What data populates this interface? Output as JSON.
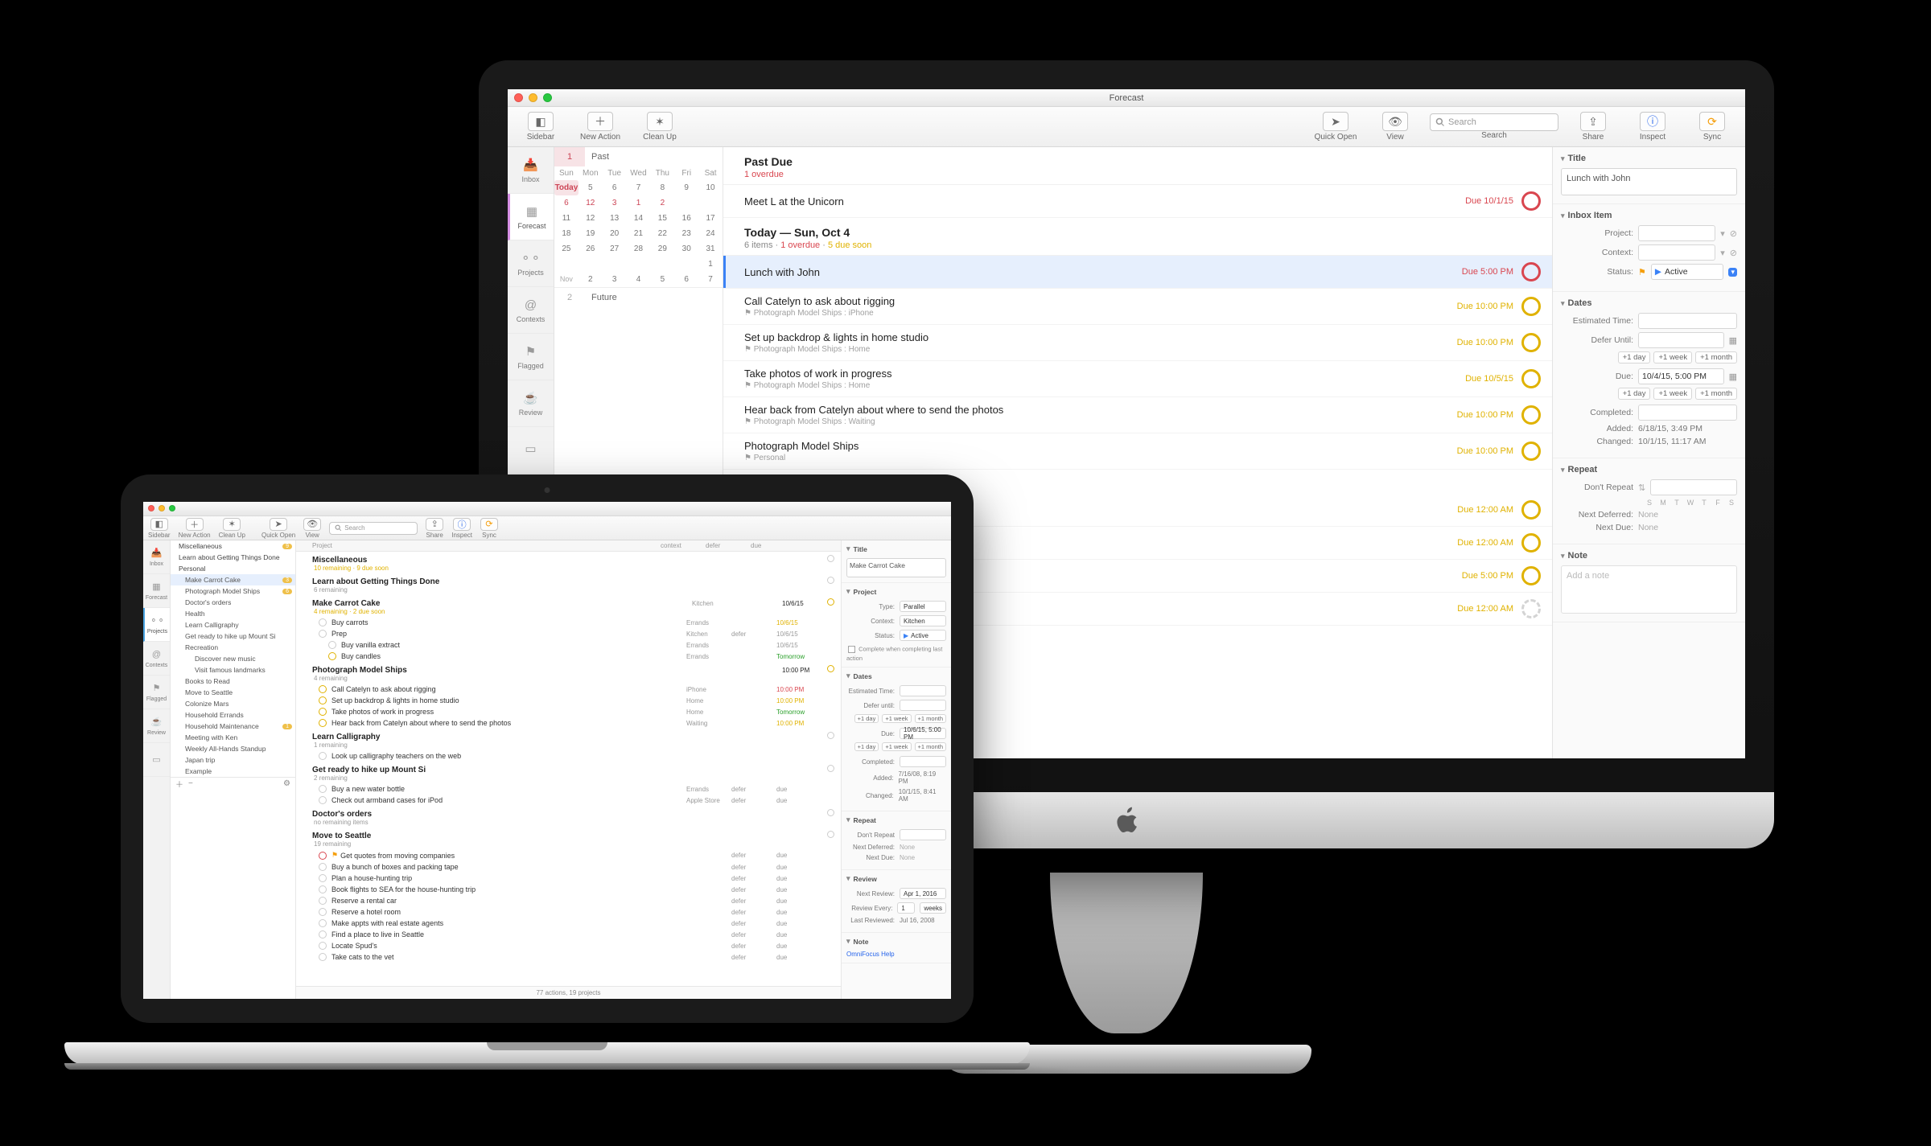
{
  "imac": {
    "windowTitle": "Forecast",
    "toolbar": {
      "sidebar": "Sidebar",
      "newAction": "New Action",
      "cleanUp": "Clean Up",
      "quickOpen": "Quick Open",
      "view": "View",
      "searchPlaceholder": "Search",
      "searchLabel": "Search",
      "share": "Share",
      "inspect": "Inspect",
      "sync": "Sync"
    },
    "perspectives": [
      "Inbox",
      "Forecast",
      "Projects",
      "Contexts",
      "Flagged",
      "Review"
    ],
    "cal": {
      "pastCount": "1",
      "pastLabel": "Past",
      "futureCount": "2",
      "futureLabel": "Future",
      "dowNames": [
        "Sun",
        "Mon",
        "Tue",
        "Wed",
        "Thu",
        "Fri",
        "Sat"
      ],
      "todayLabel": "Today",
      "rows": [
        [
          "Today",
          "5",
          "6",
          "7",
          "8",
          "9",
          "10"
        ],
        [
          "6",
          "12",
          "3",
          "1",
          "2",
          "",
          ""
        ],
        [
          "11",
          "12",
          "13",
          "14",
          "15",
          "16",
          "17"
        ],
        [
          "18",
          "19",
          "20",
          "21",
          "22",
          "23",
          "24"
        ],
        [
          "25",
          "26",
          "27",
          "28",
          "29",
          "30",
          "31"
        ],
        [
          "",
          "",
          "",
          "",
          "",
          "",
          "1"
        ],
        [
          "Nov",
          "2",
          "3",
          "4",
          "5",
          "6",
          "7"
        ]
      ]
    },
    "sections": {
      "pastDue": {
        "title": "Past Due",
        "sub": "1 overdue"
      },
      "today": {
        "title": "Today — Sun, Oct 4",
        "sub_items": "6 items",
        "sub_overdue": "1 overdue",
        "sub_duesoon": "5 due soon"
      }
    },
    "tasks": {
      "pastDue": [
        {
          "title": "Meet L at the Unicorn",
          "due": "Due 10/1/15",
          "color": "red"
        }
      ],
      "today": [
        {
          "title": "Lunch with John",
          "meta": "",
          "due": "Due 5:00 PM",
          "color": "red",
          "selected": true
        },
        {
          "title": "Call Catelyn to ask about rigging",
          "meta": "Photograph Model Ships : iPhone",
          "due": "Due 10:00 PM",
          "color": "y"
        },
        {
          "title": "Set up backdrop & lights in home studio",
          "meta": "Photograph Model Ships : Home",
          "due": "Due 10:00 PM",
          "color": "y"
        },
        {
          "title": "Take photos of work in progress",
          "meta": "Photograph Model Ships : Home",
          "due": "Due 10/5/15",
          "color": "y"
        },
        {
          "title": "Hear back from Catelyn about where to send the photos",
          "meta": "Photograph Model Ships : Waiting",
          "due": "Due 10:00 PM",
          "color": "y"
        },
        {
          "title": "Photograph Model Ships",
          "meta": "Personal",
          "due": "Due 10:00 PM",
          "color": "y"
        }
      ],
      "later": [
        {
          "title": "",
          "due": "Due 12:00 AM",
          "color": "y"
        },
        {
          "title": "",
          "due": "Due 12:00 AM",
          "color": "y"
        },
        {
          "title": "",
          "due": "Due 5:00 PM",
          "color": "y"
        },
        {
          "title": "",
          "due": "Due 12:00 AM",
          "color": "grey"
        }
      ]
    },
    "inspector": {
      "titleSection": "Title",
      "titleValue": "Lunch with John",
      "inboxItem": "Inbox Item",
      "projectLabel": "Project:",
      "contextLabel": "Context:",
      "statusLabel": "Status:",
      "statusValue": "Active",
      "dates": "Dates",
      "estTime": "Estimated Time:",
      "deferUntil": "Defer Until:",
      "dueLabel": "Due:",
      "dueValue": "10/4/15, 5:00 PM",
      "completed": "Completed:",
      "addedLabel": "Added:",
      "addedValue": "6/18/15, 3:49 PM",
      "changedLabel": "Changed:",
      "changedValue": "10/1/15, 11:17 AM",
      "chips": [
        "+1 day",
        "+1 week",
        "+1 month"
      ],
      "repeat": "Repeat",
      "repeatValue": "Don't Repeat",
      "dow": [
        "S",
        "M",
        "T",
        "W",
        "T",
        "F",
        "S"
      ],
      "nextDeferred": "Next Deferred:",
      "nextDue": "Next Due:",
      "none": "None",
      "noteSection": "Note",
      "notePlaceholder": "Add a note"
    }
  },
  "macbook": {
    "toolbar": {
      "sidebar": "Sidebar",
      "newAction": "New Action",
      "cleanUp": "Clean Up",
      "quickOpen": "Quick Open",
      "view": "View",
      "searchPlaceholder": "Search",
      "searchLabel": "Search",
      "share": "Share",
      "inspect": "Inspect",
      "sync": "Sync"
    },
    "perspectives": [
      "Inbox",
      "Forecast",
      "Projects",
      "Contexts",
      "Flagged",
      "Review",
      ""
    ],
    "sidebar": [
      {
        "t": "Miscellaneous",
        "b": "9",
        "bg": "y"
      },
      {
        "t": "Learn about Getting Things Done",
        "lvl": 0
      },
      {
        "t": "Personal",
        "lvl": 0
      },
      {
        "t": "Make Carrot Cake",
        "lvl": 1,
        "b": "3",
        "bg": "y",
        "sel": true
      },
      {
        "t": "Photograph Model Ships",
        "lvl": 1,
        "b": "6",
        "bg": "y"
      },
      {
        "t": "Doctor's orders",
        "lvl": 1
      },
      {
        "t": "Health",
        "lvl": 1
      },
      {
        "t": "Learn Calligraphy",
        "lvl": 1
      },
      {
        "t": "Get ready to hike up Mount Si",
        "lvl": 1
      },
      {
        "t": "Recreation",
        "lvl": 1
      },
      {
        "t": "Discover new music",
        "lvl": 2
      },
      {
        "t": "Visit famous landmarks",
        "lvl": 2
      },
      {
        "t": "Books to Read",
        "lvl": 1
      },
      {
        "t": "Move to Seattle",
        "lvl": 1
      },
      {
        "t": "Colonize Mars",
        "lvl": 1
      },
      {
        "t": "Household Errands",
        "lvl": 1
      },
      {
        "t": "Household Maintenance",
        "lvl": 1,
        "b": "1",
        "bg": "y"
      },
      {
        "t": "Meeting with Ken",
        "lvl": 1
      },
      {
        "t": "Weekly All-Hands Standup",
        "lvl": 1
      },
      {
        "t": "Japan trip",
        "lvl": 1
      },
      {
        "t": "Example",
        "lvl": 1
      }
    ],
    "cols": [
      "Project",
      "context",
      "defer",
      "due",
      ""
    ],
    "outline": [
      {
        "type": "proj",
        "t": "Miscellaneous",
        "rem": "10 remaining · 9 due soon",
        "ds": true
      },
      {
        "type": "proj",
        "t": "Learn about Getting Things Done",
        "rem": "6 remaining"
      },
      {
        "type": "proj",
        "t": "Make Carrot Cake",
        "rem": "4 remaining · 2 due soon",
        "ds": true,
        "sel": true,
        "c1": "Kitchen",
        "c2": "",
        "c3": "10/6/15",
        "cc": "y"
      },
      {
        "type": "row",
        "t": "Buy carrots",
        "c1": "Errands",
        "c3": "10/6/15",
        "cc": "y"
      },
      {
        "type": "row",
        "t": "Prep",
        "c1": "Kitchen",
        "c2": "defer",
        "c3": "10/6/15"
      },
      {
        "type": "row",
        "lvl": 2,
        "t": "Buy vanilla extract",
        "c1": "Errands",
        "c3": "10/6/15"
      },
      {
        "type": "row",
        "lvl": 2,
        "t": "Buy candles",
        "c1": "Errands",
        "c3": "Tomorrow",
        "cc": "grn",
        "rc": "y"
      },
      {
        "type": "proj",
        "t": "Photograph Model Ships",
        "rem": "4 remaining",
        "c3": "10:00 PM",
        "cc": "y"
      },
      {
        "type": "row",
        "t": "Call Catelyn to ask about rigging",
        "c1": "iPhone",
        "c3": "10:00 PM",
        "cc": "red",
        "rc": "y"
      },
      {
        "type": "row",
        "t": "Set up backdrop & lights in home studio",
        "c1": "Home",
        "c3": "10:00 PM",
        "cc": "y",
        "rc": "y"
      },
      {
        "type": "row",
        "t": "Take photos of work in progress",
        "c1": "Home",
        "c3": "Tomorrow",
        "cc": "grn",
        "rc": "y"
      },
      {
        "type": "row",
        "t": "Hear back from Catelyn about where to send the photos",
        "c1": "Waiting",
        "c3": "10:00 PM",
        "cc": "y",
        "rc": "y"
      },
      {
        "type": "proj",
        "t": "Learn Calligraphy",
        "rem": "1 remaining"
      },
      {
        "type": "row",
        "t": "Look up calligraphy teachers on the web"
      },
      {
        "type": "proj",
        "t": "Get ready to hike up Mount Si",
        "rem": "2 remaining"
      },
      {
        "type": "row",
        "t": "Buy a new water bottle",
        "c1": "Errands",
        "c2": "defer",
        "c3": "due"
      },
      {
        "type": "row",
        "t": "Check out armband cases for iPod",
        "c1": "Apple Store",
        "c2": "defer",
        "c3": "due"
      },
      {
        "type": "proj",
        "t": "Doctor's orders",
        "rem": "no remaining items"
      },
      {
        "type": "proj",
        "t": "Move to Seattle",
        "rem": "19 remaining"
      },
      {
        "type": "row",
        "t": "Get quotes from moving companies",
        "rc": "r",
        "flag": true,
        "c2": "defer",
        "c3": "due"
      },
      {
        "type": "row",
        "t": "Buy a bunch of boxes and packing tape",
        "c2": "defer",
        "c3": "due"
      },
      {
        "type": "row",
        "t": "Plan a house-hunting trip",
        "c2": "defer",
        "c3": "due"
      },
      {
        "type": "row",
        "t": "Book flights to SEA for the house-hunting trip",
        "c2": "defer",
        "c3": "due"
      },
      {
        "type": "row",
        "t": "Reserve a rental car",
        "c2": "defer",
        "c3": "due"
      },
      {
        "type": "row",
        "t": "Reserve a hotel room",
        "c2": "defer",
        "c3": "due"
      },
      {
        "type": "row",
        "t": "Make appts with real estate agents",
        "c2": "defer",
        "c3": "due"
      },
      {
        "type": "row",
        "t": "Find a place to live in Seattle",
        "c2": "defer",
        "c3": "due"
      },
      {
        "type": "row",
        "t": "Locate Spud's",
        "c2": "defer",
        "c3": "due"
      },
      {
        "type": "row",
        "t": "Take cats to the vet",
        "c2": "defer",
        "c3": "due"
      }
    ],
    "status": "77 actions, 19 projects",
    "inspector": {
      "titleSection": "Title",
      "titleValue": "Make Carrot Cake",
      "project": "Project",
      "typeLabel": "Type:",
      "typeValue": "Parallel",
      "contextLabel": "Context:",
      "contextValue": "Kitchen",
      "statusLabel": "Status:",
      "statusValue": "Active",
      "completeWhen": "Complete when completing last action",
      "dates": "Dates",
      "estTime": "Estimated Time:",
      "deferUntil": "Defer until:",
      "chips": [
        "+1 day",
        "+1 week",
        "+1 month"
      ],
      "dueLabel": "Due:",
      "dueValue": "10/6/15, 5:00 PM",
      "completed": "Completed:",
      "addedLabel": "Added:",
      "addedValue": "7/16/08, 8:19 PM",
      "changedLabel": "Changed:",
      "changedValue": "10/1/15, 8:41 AM",
      "repeat": "Repeat",
      "repeatValue": "Don't Repeat",
      "nextDeferred": "Next Deferred:",
      "nextDue": "Next Due:",
      "none": "None",
      "review": "Review",
      "nextReviewLabel": "Next Review:",
      "nextReviewValue": "Apr 1, 2016",
      "reviewEveryLabel": "Review Every:",
      "reviewEveryValue": "1",
      "reviewEveryUnit": "weeks",
      "lastReviewedLabel": "Last Reviewed:",
      "lastReviewedValue": "Jul 16, 2008",
      "note": "Note",
      "noteLink": "OmniFocus Help"
    }
  }
}
